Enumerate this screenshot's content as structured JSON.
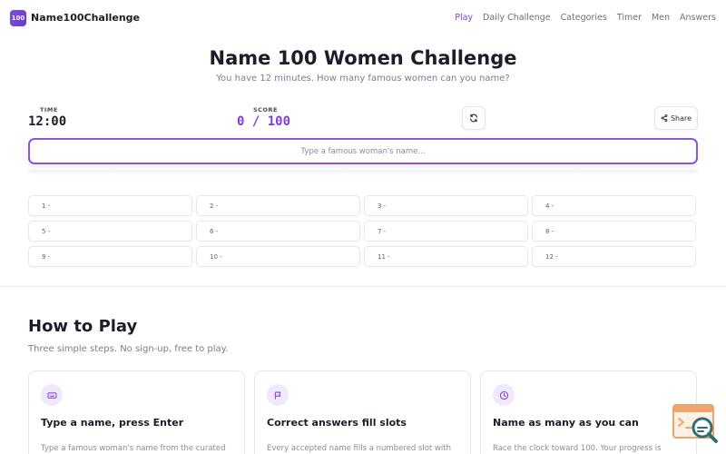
{
  "header": {
    "logo_text": "100",
    "brand": "Name100Challenge",
    "nav": [
      "Play",
      "Daily Challenge",
      "Categories",
      "Timer",
      "Men",
      "Answers"
    ],
    "active_nav": "Play"
  },
  "game": {
    "title": "Name 100 Women Challenge",
    "subtitle": "You have 12 minutes. How many famous women can you name?",
    "time_label": "TIME",
    "time_value": "12:00",
    "score_label": "SCORE",
    "score_value": "0 / 100",
    "share_label": "Share",
    "input_placeholder": "Type a famous woman's name...",
    "slots": [
      "1 -",
      "2 -",
      "3 -",
      "4 -",
      "5 -",
      "6 -",
      "7 -",
      "8 -",
      "9 -",
      "10 -",
      "11 -",
      "12 -"
    ]
  },
  "how_to_play": {
    "title": "How to Play",
    "subtitle": "Three simple steps. No sign-up, free to play.",
    "cards": [
      {
        "icon": "keyboard-icon",
        "title": "Type a name, press Enter",
        "text": "Type a famous woman's name from the curated"
      },
      {
        "icon": "flag-icon",
        "title": "Correct answers fill slots",
        "text": "Every accepted name fills a numbered slot with"
      },
      {
        "icon": "clock-icon",
        "title": "Name as many as you can",
        "text": "Race the clock toward 100. Your progress is"
      }
    ]
  },
  "colors": {
    "accent": "#7b46d6",
    "input_border": "#8a56dc",
    "score": "#7a3fd9"
  }
}
